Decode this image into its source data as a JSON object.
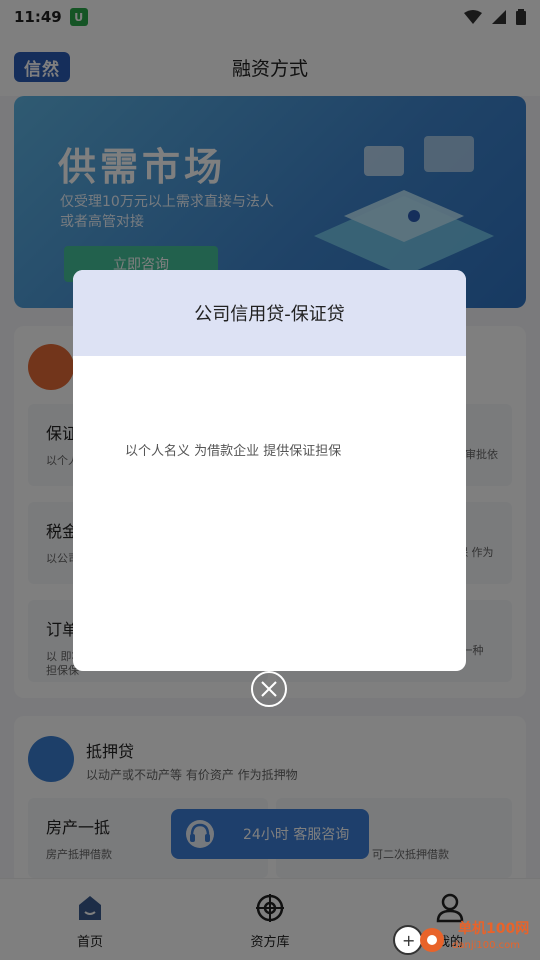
{
  "status": {
    "time": "11:49",
    "badge": "U"
  },
  "header": {
    "logo": "信然",
    "title": "融资方式"
  },
  "banner": {
    "title": "供需市场",
    "subtitle": "仅受理10万元以上需求直接与法人或者高管对接",
    "button": "立即咨询"
  },
  "card1": {
    "tiles": [
      {
        "name": "保证",
        "desc": "以个人"
      },
      {
        "name": "税金",
        "desc": "以公司"
      },
      {
        "name": "订单",
        "desc": "以 即将",
        "desc2": "担保保"
      }
    ],
    "right_snips": [
      "为审批依",
      "担保 作为",
      "量的 一种"
    ]
  },
  "card2": {
    "title": "抵押贷",
    "subtitle": "以动产或不动产等 有价资产 作为抵押物",
    "tile_left": {
      "name": "房产一抵",
      "desc": "房产抵押借款"
    },
    "tile_right_desc": "可二次抵押借款"
  },
  "float_button": {
    "label": "24小时  客服咨询"
  },
  "bottom_nav": [
    {
      "label": "首页"
    },
    {
      "label": "资方库"
    },
    {
      "label": "我的"
    }
  ],
  "modal": {
    "title": "公司信用贷-保证贷",
    "body": "以个人名义 为借款企业 提供保证担保"
  },
  "watermark": {
    "text": "单机100网",
    "url": "danji100.com"
  },
  "colors": {
    "primary": "#3d7ed8",
    "modal_header": "#dde2f4",
    "accent_orange": "#e46a36"
  }
}
